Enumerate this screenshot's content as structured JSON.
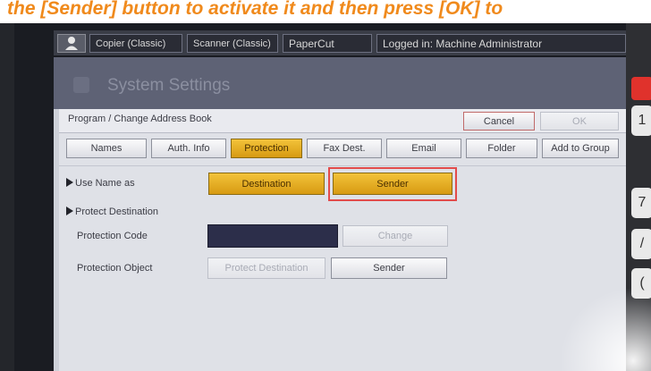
{
  "banner": {
    "text": "the [Sender] button to activate it and then press [OK] to"
  },
  "topbar": {
    "items": [
      "Copier (Classic)",
      "Scanner (Classic)",
      "PaperCut",
      "Logged in: Machine Administrator"
    ]
  },
  "screen": {
    "title": "System Settings",
    "form_title": "Program / Change Address Book",
    "cancel_label": "Cancel",
    "ok_label": "OK",
    "tabs": [
      "Names",
      "Auth. Info",
      "Protection",
      "Fax Dest.",
      "Email",
      "Folder",
      "Add to Group"
    ],
    "active_tab": "Protection",
    "use_name_as": {
      "label": "Use Name as",
      "destination_label": "Destination",
      "sender_label": "Sender"
    },
    "protect_destination": {
      "label": "Protect Destination",
      "code_label": "Protection Code",
      "change_label": "Change",
      "object_label": "Protection Object",
      "object_options": [
        "Protect Destination",
        "Sender"
      ]
    }
  },
  "hardware_keys": [
    "1",
    "7",
    "/",
    "("
  ],
  "colors": {
    "active": "#e0a71c",
    "highlight": "#e24b4b",
    "banner_text": "#f08a1c"
  }
}
